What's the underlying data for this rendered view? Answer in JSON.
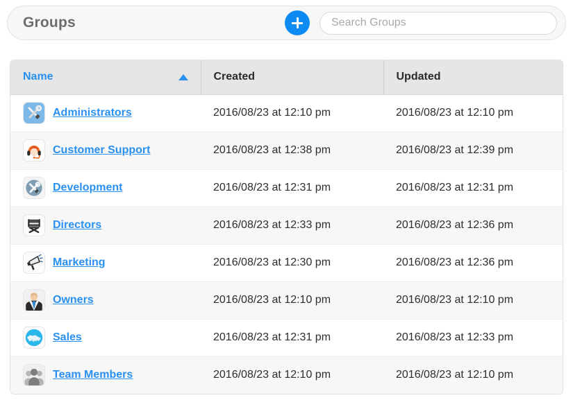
{
  "toolbar": {
    "title": "Groups",
    "add_label": "+",
    "add_name": "add-group-button",
    "search_placeholder": "Search Groups",
    "search_value": "",
    "accent_color": "#0d8bf2"
  },
  "table": {
    "columns": [
      {
        "key": "name",
        "label": "Name",
        "sorted": true,
        "sort_dir": "asc"
      },
      {
        "key": "created",
        "label": "Created",
        "sorted": false,
        "sort_dir": ""
      },
      {
        "key": "updated",
        "label": "Updated",
        "sorted": false,
        "sort_dir": ""
      }
    ],
    "link_color": "#2a90f0",
    "rows": [
      {
        "icon": "tools-wrench-screwdriver-icon",
        "name": "Administrators",
        "created": "2016/08/23 at 12:10 pm",
        "updated": "2016/08/23 at 12:10 pm"
      },
      {
        "icon": "headset-support-agent-icon",
        "name": "Customer Support",
        "created": "2016/08/23 at 12:38 pm",
        "updated": "2016/08/23 at 12:39 pm"
      },
      {
        "icon": "tools-circle-icon",
        "name": "Development",
        "created": "2016/08/23 at 12:31 pm",
        "updated": "2016/08/23 at 12:31 pm"
      },
      {
        "icon": "director-chair-icon",
        "name": "Directors",
        "created": "2016/08/23 at 12:33 pm",
        "updated": "2016/08/23 at 12:36 pm"
      },
      {
        "icon": "megaphone-icon",
        "name": "Marketing",
        "created": "2016/08/23 at 12:30 pm",
        "updated": "2016/08/23 at 12:36 pm"
      },
      {
        "icon": "businessman-suit-icon",
        "name": "Owners",
        "created": "2016/08/23 at 12:10 pm",
        "updated": "2016/08/23 at 12:10 pm"
      },
      {
        "icon": "handshake-circle-icon",
        "name": "Sales",
        "created": "2016/08/23 at 12:31 pm",
        "updated": "2016/08/23 at 12:33 pm"
      },
      {
        "icon": "people-group-icon",
        "name": "Team Members",
        "created": "2016/08/23 at 12:10 pm",
        "updated": "2016/08/23 at 12:10 pm"
      }
    ]
  }
}
